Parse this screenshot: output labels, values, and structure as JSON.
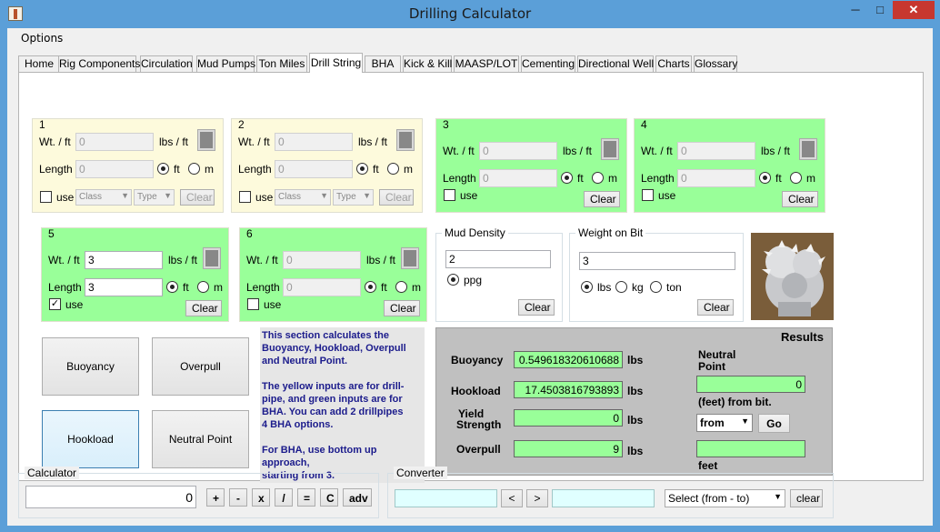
{
  "window": {
    "title": "Drilling Calculator",
    "min": "─",
    "max": "□",
    "close": "✕"
  },
  "menu": {
    "options": "Options"
  },
  "tabs": [
    "Home",
    "Rig Components",
    "Circulation",
    "Mud Pumps",
    "Ton Miles",
    "Drill String",
    "BHA",
    "Kick & Kill",
    "MAASP/LOT",
    "Cementing",
    "Directional Well",
    "Charts",
    "Glossary"
  ],
  "active_tab": "Drill String",
  "labels": {
    "wt": "Wt. / ft",
    "length": "Length",
    "lbs_ft": "lbs / ft",
    "ft": "ft",
    "m": "m",
    "use": "use",
    "clear": "Clear",
    "class": "Class",
    "type": "Type"
  },
  "sections": [
    {
      "title": "1",
      "color": "#fdfadc",
      "wt": "0",
      "length": "0",
      "use": false,
      "enabled": false
    },
    {
      "title": "2",
      "color": "#fdfadc",
      "wt": "0",
      "length": "0",
      "use": false,
      "enabled": false
    },
    {
      "title": "3",
      "color": "#99ff99",
      "wt": "0",
      "length": "0",
      "use": false,
      "enabled": false
    },
    {
      "title": "4",
      "color": "#99ff99",
      "wt": "0",
      "length": "0",
      "use": false,
      "enabled": false
    },
    {
      "title": "5",
      "color": "#99ff99",
      "wt": "3",
      "length": "3",
      "use": true,
      "enabled": true
    },
    {
      "title": "6",
      "color": "#99ff99",
      "wt": "0",
      "length": "0",
      "use": false,
      "enabled": false
    }
  ],
  "mud_density": {
    "title": "Mud Density",
    "value": "2",
    "unit": "ppg",
    "clear": "Clear"
  },
  "weight_on_bit": {
    "title": "Weight on Bit",
    "value": "3",
    "units": [
      "lbs",
      "kg",
      "ton"
    ],
    "selected": "lbs",
    "clear": "Clear"
  },
  "buttons": {
    "buoyancy": "Buoyancy",
    "overpull": "Overpull",
    "hookload": "Hookload",
    "neutral_point": "Neutral Point"
  },
  "info_text": [
    "This section calculates the",
    "Buoyancy, Hookload, Overpull",
    "and Neutral Point.",
    "",
    "The yellow inputs are for drill-",
    "pipe, and green inputs are for",
    "BHA. You can add 2 drillpipes",
    "4 BHA options.",
    "",
    "For BHA, use bottom up approach,",
    "starting from 3."
  ],
  "results": {
    "title": "Results",
    "buoyancy_label": "Buoyancy",
    "buoyancy": "0.549618320610688",
    "buoyancy_unit": "lbs",
    "hookload_label": "Hookload",
    "hookload": "17.4503816793893",
    "hookload_unit": "lbs",
    "yield_label_1": "Yield",
    "yield_label_2": "Strength",
    "yield": "0",
    "yield_unit": "lbs",
    "overpull_label": "Overpull",
    "overpull": "9",
    "overpull_unit": "lbs",
    "neutral_label_1": "Neutral",
    "neutral_label_2": "Point",
    "neutral": "0",
    "neutral_unit": "(feet) from bit.",
    "from_select": "from",
    "go": "Go",
    "feet": "feet",
    "feet_value": ""
  },
  "calculator": {
    "title": "Calculator",
    "display": "0",
    "keys": [
      "+",
      "-",
      "x",
      "/",
      "=",
      "C",
      "adv"
    ]
  },
  "converter": {
    "title": "Converter",
    "left_value": "",
    "right_value": "",
    "prev": "<",
    "next": ">",
    "select": "Select (from - to)",
    "clear": "clear"
  }
}
